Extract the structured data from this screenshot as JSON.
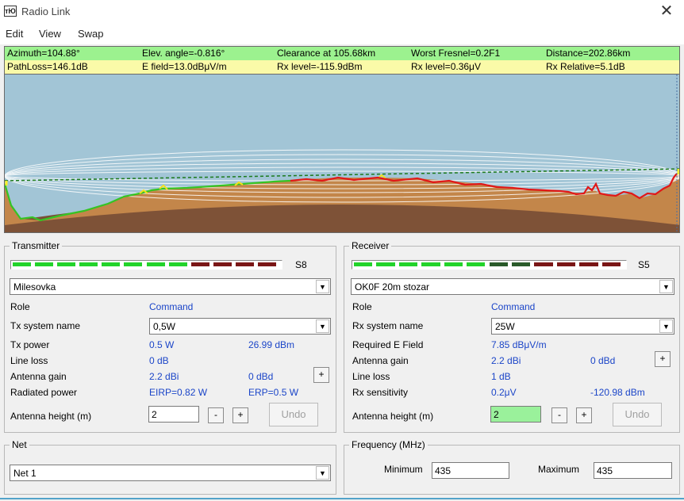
{
  "window": {
    "title": "Radio Link",
    "icon_text": "тЮ"
  },
  "menu": {
    "items": [
      "Edit",
      "View",
      "Swap"
    ]
  },
  "info": {
    "row1": [
      "Azimuth=104.88°",
      "Elev. angle=-0.816°",
      "Clearance at 105.68km",
      "Worst Fresnel=0.2F1",
      "Distance=202.86km"
    ],
    "row2": [
      "PathLoss=146.1dB",
      "E field=13.0dBμV/m",
      "Rx level=-115.9dBm",
      "Rx level=0.36μV",
      "Rx Relative=5.1dB"
    ]
  },
  "colors": {
    "info_row1": "#9cf28f",
    "info_row2": "#fafaa8",
    "sky": "#a2c5d6",
    "terrain_brown": "#c3864a",
    "earth_dark": "#7a4f36",
    "green_profile": "#35c424",
    "red_profile": "#e11818",
    "link_accent": "#1b45c8",
    "field_highlight": "#9af19b"
  },
  "transmitter": {
    "group_label": "Transmitter",
    "s_meter": {
      "label": "S8",
      "level_fraction": 0.55
    },
    "site": "Milesovka",
    "role_label": "Role",
    "role_value": "Command",
    "tx_system_label": "Tx system name",
    "tx_system_value": "0,5W",
    "tx_power_label": "Tx power",
    "tx_power_w": "0.5 W",
    "tx_power_dbm": "26.99 dBm",
    "line_loss_label": "Line loss",
    "line_loss_value": "0 dB",
    "antenna_gain_label": "Antenna gain",
    "antenna_gain_dbi": "2.2 dBi",
    "antenna_gain_dbd": "0 dBd",
    "radiated_power_label": "Radiated power",
    "eirp": "EIRP=0.82 W",
    "erp": "ERP=0.5 W",
    "antenna_height_label": "Antenna height (m)",
    "antenna_height_value": "2",
    "undo_label": "Undo",
    "minus_label": "-",
    "plus_label": "+"
  },
  "receiver": {
    "group_label": "Receiver",
    "s_meter": {
      "label": "S5",
      "level_fraction": 0.4
    },
    "site": "OK0F 20m stozar",
    "role_label": "Role",
    "role_value": "Command",
    "rx_system_label": "Rx system name",
    "rx_system_value": "25W",
    "required_field_label": "Required E Field",
    "required_field_value": "7.85 dBμV/m",
    "antenna_gain_label": "Antenna gain",
    "antenna_gain_dbi": "2.2 dBi",
    "antenna_gain_dbd": "0 dBd",
    "line_loss_label": "Line loss",
    "line_loss_value": "1 dB",
    "rx_sensitivity_label": "Rx sensitivity",
    "rx_sensitivity_uv": "0.2μV",
    "rx_sensitivity_dbm": "-120.98 dBm",
    "antenna_height_label": "Antenna height (m)",
    "antenna_height_value": "2",
    "undo_label": "Undo",
    "minus_label": "-",
    "plus_label": "+"
  },
  "net": {
    "group_label": "Net",
    "value": "Net  1"
  },
  "frequency": {
    "group_label": "Frequency (MHz)",
    "minimum_label": "Minimum",
    "minimum_value": "435",
    "maximum_label": "Maximum",
    "maximum_value": "435"
  }
}
